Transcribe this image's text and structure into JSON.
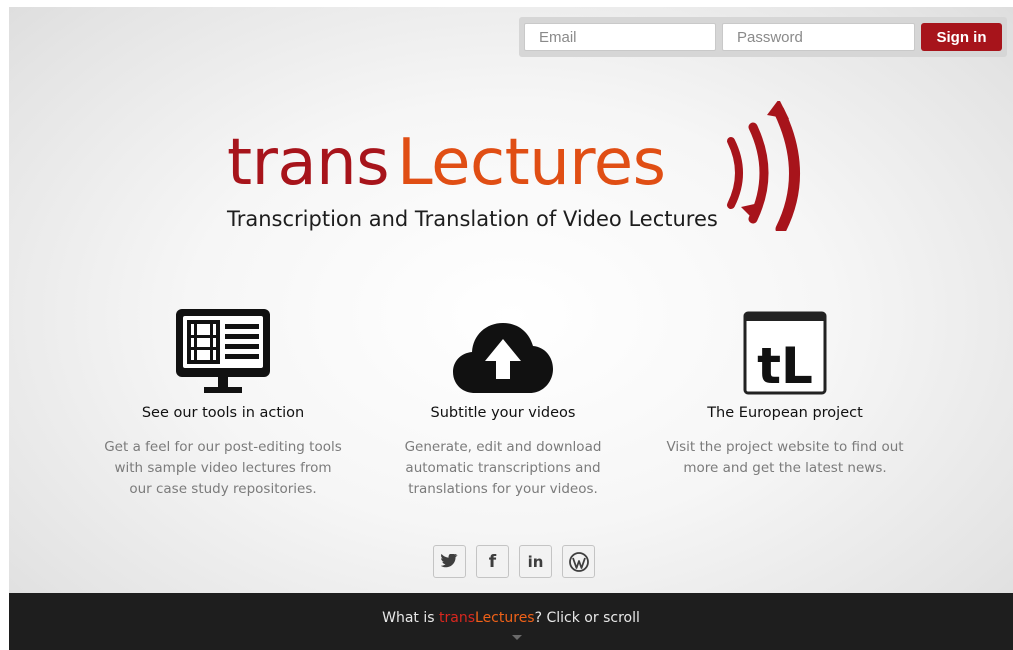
{
  "signin": {
    "email_placeholder": "Email",
    "password_placeholder": "Password",
    "button_label": "Sign in"
  },
  "logo": {
    "part1": "trans",
    "part2": "Lectures",
    "tagline": "Transcription and Translation of Video Lectures"
  },
  "features": [
    {
      "icon": "monitor-video-icon",
      "title": "See our tools in action",
      "lines": [
        "Get a feel for our post-editing tools",
        "with sample video lectures from",
        "our case study repositories."
      ]
    },
    {
      "icon": "cloud-upload-icon",
      "title": "Subtitle your videos",
      "lines": [
        "Generate, edit and download",
        "automatic transcriptions and",
        "translations for your videos."
      ]
    },
    {
      "icon": "tl-logo-icon",
      "icon_text": "tL",
      "title": "The European project",
      "lines": [
        "Visit the project website to find out",
        "more and get the latest news."
      ]
    }
  ],
  "social": [
    {
      "icon": "twitter-icon",
      "text": ""
    },
    {
      "icon": "facebook-icon",
      "text": "f"
    },
    {
      "icon": "linkedin-icon",
      "text": "in"
    },
    {
      "icon": "wordpress-icon",
      "text": ""
    }
  ],
  "footer": {
    "prefix": "What is ",
    "brand1": "trans",
    "brand2": "Lectures",
    "suffix": "? Click or scroll",
    "arrow_icon": "chevron-down-icon"
  },
  "colors": {
    "brand_red": "#a7141b",
    "brand_orange": "#e04e14",
    "footer_bg": "#1e1e1e"
  }
}
